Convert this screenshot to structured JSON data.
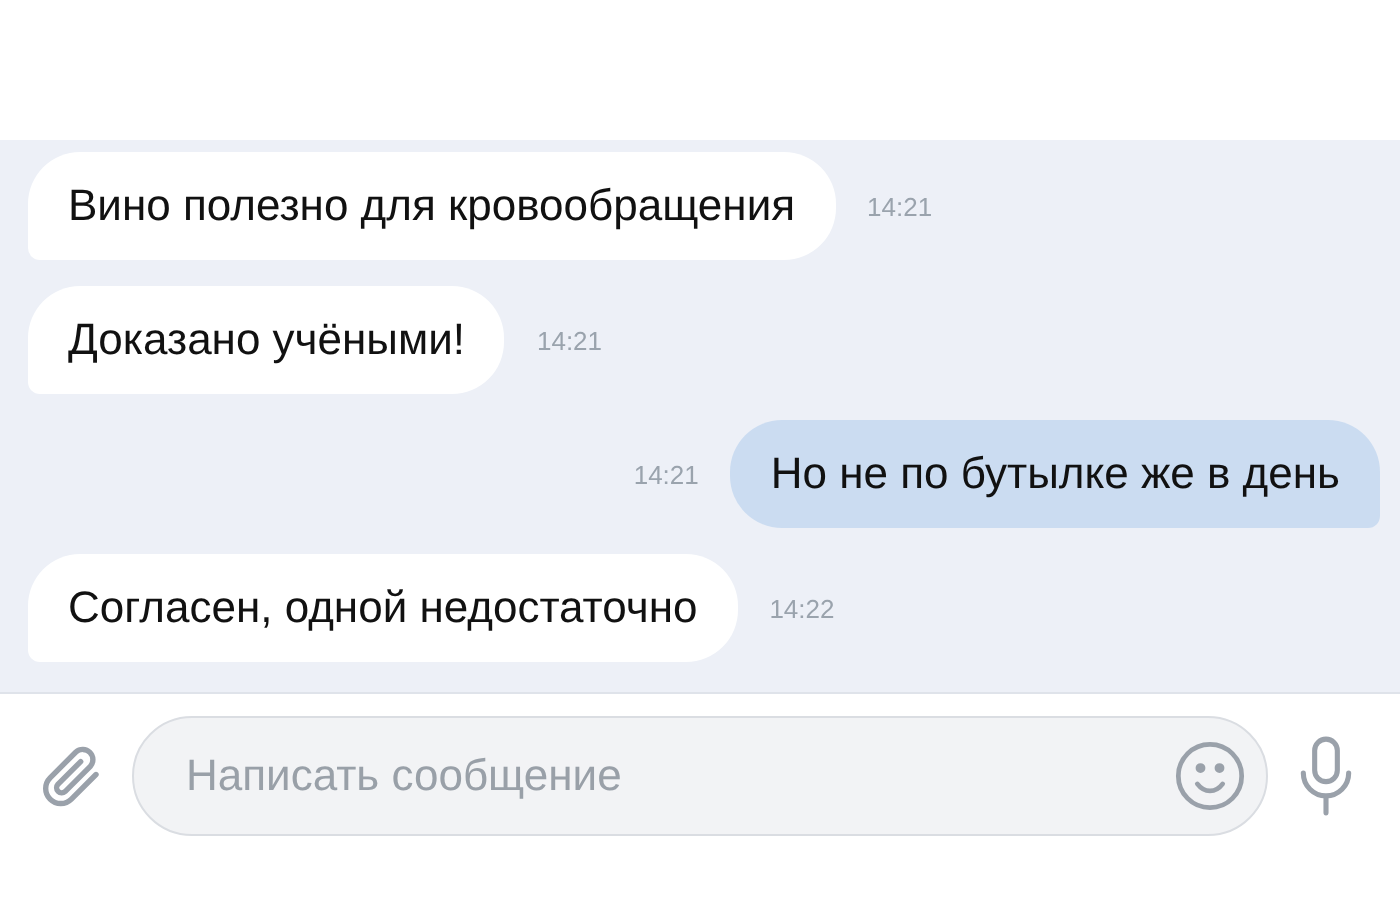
{
  "messages": [
    {
      "text": "Вино полезно для кровообращения",
      "time": "14:21",
      "outgoing": false
    },
    {
      "text": "Доказано учёными!",
      "time": "14:21",
      "outgoing": false
    },
    {
      "text": "Но не по бутылке же в день",
      "time": "14:21",
      "outgoing": true
    },
    {
      "text": "Согласен, одной недостаточно",
      "time": "14:22",
      "outgoing": false
    }
  ],
  "composer": {
    "placeholder": "Написать сообщение"
  }
}
